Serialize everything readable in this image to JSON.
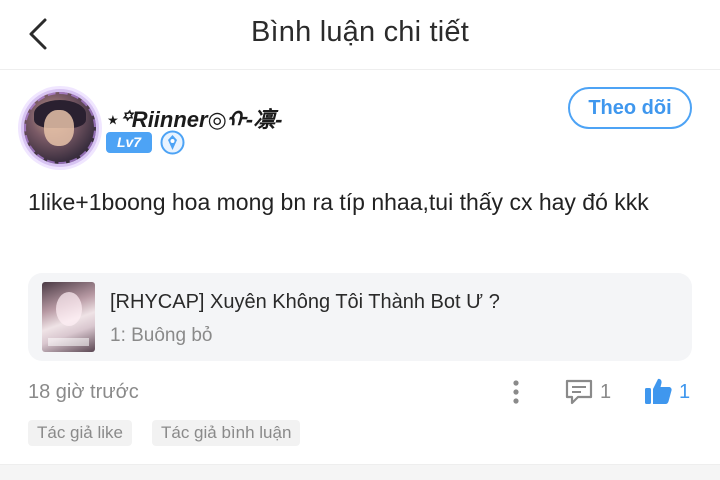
{
  "header": {
    "title": "Bình luận chi tiết",
    "back_icon": "chevron-left-icon"
  },
  "user": {
    "name": "⋆꙳Riinner◎ᡣ-凛-",
    "level": "Lv7",
    "avatar": "avatar-image",
    "badge_icon": "verified-badge-icon"
  },
  "follow_button": {
    "label": "Theo dõi"
  },
  "comment": {
    "text": "1like+1boong hoa mong bn ra típ nhaa,tui thấy cx hay đó kkk"
  },
  "story": {
    "title": "[RHYCAP] Xuyên Không Tôi Thành Bot Ư ?",
    "chapter": "1: Buông bỏ"
  },
  "meta": {
    "timestamp": "18 giờ trước",
    "reply_count": "1",
    "like_count": "1"
  },
  "tags": [
    "Tác giả like",
    "Tác giả bình luận"
  ],
  "colors": {
    "accent": "#4da3f5",
    "muted_text": "#8a8a8a",
    "card_bg": "#f4f5f7"
  }
}
